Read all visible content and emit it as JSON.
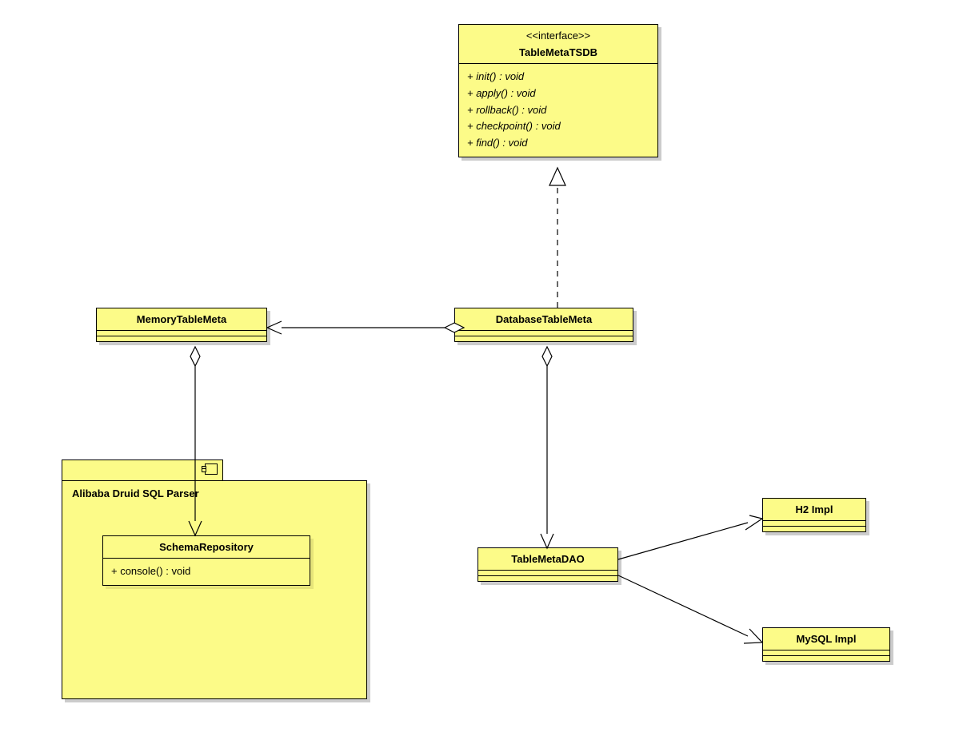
{
  "interface": {
    "stereotype": "<<interface>>",
    "name": "TableMetaTSDB",
    "methods": [
      "+ init() : void",
      "+ apply() : void",
      "+ rollback() : void",
      "+ checkpoint() : void",
      "+ find() : void"
    ]
  },
  "memoryTableMeta": {
    "name": "MemoryTableMeta"
  },
  "databaseTableMeta": {
    "name": "DatabaseTableMeta"
  },
  "package": {
    "name": "Alibaba Druid SQL Parser",
    "schemaRepo": {
      "name": "SchemaRepository",
      "methods": [
        "+ console() : void"
      ]
    }
  },
  "tableMetaDAO": {
    "name": "TableMetaDAO"
  },
  "h2Impl": {
    "name": "H2 Impl"
  },
  "mysqlImpl": {
    "name": "MySQL Impl"
  }
}
